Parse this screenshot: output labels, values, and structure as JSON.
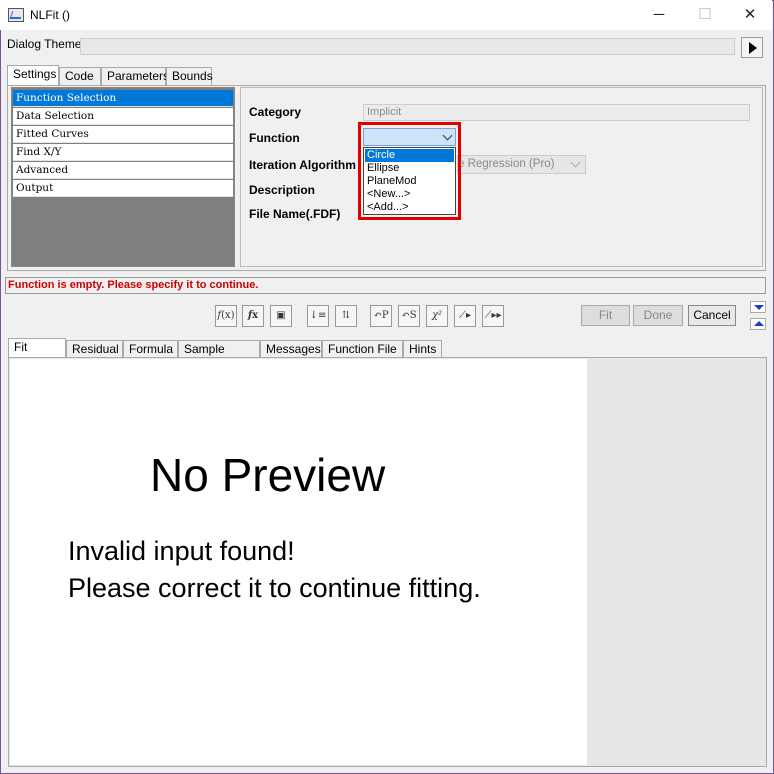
{
  "window": {
    "title": "NLFit ()"
  },
  "dialog_theme": {
    "label": "Dialog Theme",
    "value": ""
  },
  "settings_tabs": [
    "Settings",
    "Code",
    "Parameters",
    "Bounds"
  ],
  "tree": {
    "items": [
      "Function Selection",
      "Data Selection",
      "Fitted Curves",
      "Find X/Y",
      "Advanced",
      "Output"
    ],
    "selected_index": 0
  },
  "form": {
    "category_label": "Category",
    "category_value": "Implicit",
    "function_label": "Function",
    "function_value": "",
    "iteration_label": "Iteration Algorithm",
    "iteration_value_visible": "e Regression (Pro)",
    "description_label": "Description",
    "filename_label": "File Name(.FDF)"
  },
  "function_dropdown": {
    "options": [
      "Circle",
      "Ellipse",
      "PlaneMod",
      "<New...>",
      "<Add...>"
    ],
    "highlighted_index": 0
  },
  "status": {
    "message": "Function is empty. Please specify it to continue.",
    "color": "#d00000"
  },
  "toolbar": {
    "icons": [
      "fx-edit-icon",
      "fx-function-icon",
      "save-icon",
      "sort-down-icon",
      "tree-icon",
      "undo-p-icon",
      "undo-s-icon",
      "chi-square-icon",
      "iterate-icon",
      "fit-until-converged-icon"
    ],
    "fit_label": "Fit",
    "done_label": "Done",
    "cancel_label": "Cancel"
  },
  "bottom_tabs": [
    "Fit Curve",
    "Residual",
    "Formula",
    "Sample Curve",
    "Messages",
    "Function File",
    "Hints"
  ],
  "preview": {
    "title": "No Preview",
    "line1": "Invalid input found!",
    "line2": "Please correct it to continue fitting."
  },
  "colors": {
    "selection": "#0078d7",
    "highlight_border": "#e00000",
    "nav_arrow": "#1a3fc8"
  }
}
